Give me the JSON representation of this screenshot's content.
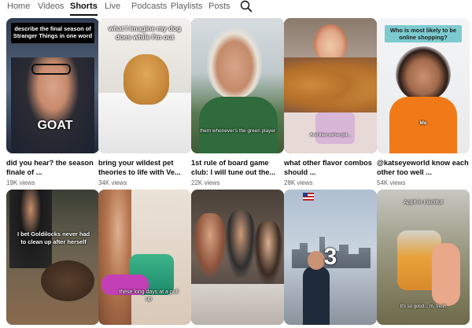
{
  "tabs": [
    {
      "label": "Home"
    },
    {
      "label": "Videos"
    },
    {
      "label": "Shorts"
    },
    {
      "label": "Live"
    },
    {
      "label": "Podcasts"
    },
    {
      "label": "Playlists"
    },
    {
      "label": "Posts"
    }
  ],
  "active_tab": "Shorts",
  "shorts": [
    {
      "title": "did you hear? the season finale of ...",
      "views": "19K views",
      "overlay_top": "describe the final season of Stranger Things in one word",
      "overlay_mid": "GOAT"
    },
    {
      "title": "bring your wildest pet theories to life with Ve...",
      "views": "34K views",
      "overlay_top": "what I imagine my dog does while I'm out"
    },
    {
      "title": "1st rule of board game club: I will tune out the...",
      "views": "22K views",
      "overlay_bottom": "them whenever's the green player"
    },
    {
      "title": "what other flavor combos should ...",
      "views": "28K views",
      "overlay_bottom": "And then we've got..."
    },
    {
      "title": "@katseyeworld know each other too well ...",
      "views": "54K views",
      "overlay_top": "Who is most likely to be online shopping?",
      "overlay_mid": "Me"
    },
    {
      "overlay_top": "I bet Goldilocks never had to clean up after herself"
    },
    {
      "overlay_bottom": "these long days at a pull up"
    },
    {},
    {
      "overlay_mid": "3"
    },
    {
      "overlay_top": "Applt in Inkotltut",
      "overlay_bottom": "It's so good... m, fresh"
    }
  ],
  "colors": {
    "text_primary": "#0f0f0f",
    "text_secondary": "#606060",
    "active_underline": "#0f0f0f"
  }
}
